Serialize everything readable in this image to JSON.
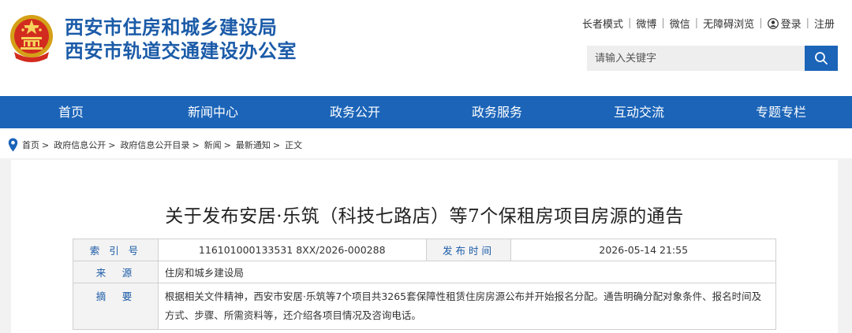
{
  "header": {
    "org_name_1": "西安市住房和城乡建设局",
    "org_name_2": "西安市轨道交通建设办公室",
    "emblem_icon": "national-emblem-icon",
    "toplinks": [
      "长者模式",
      "微博",
      "微信",
      "无障碍浏览"
    ],
    "login": "登录",
    "register": "注册",
    "search_placeholder": "请输入关键字",
    "accent_color": "#1b64b8"
  },
  "nav": {
    "items": [
      "首页",
      "新闻中心",
      "政务公开",
      "政务服务",
      "互动交流",
      "专题专栏"
    ]
  },
  "breadcrumb": [
    "首页",
    "政府信息公开",
    "政府信息公开目录",
    "新闻",
    "最新通知",
    "正文"
  ],
  "article": {
    "title": "关于发布安居·乐筑（科技七路店）等7个保租房项目房源的通告",
    "meta": {
      "index_label": "索 引 号",
      "index_value": "116101000133531 8XX/2026-000288",
      "date_label": "发布时间",
      "date_value": "2026-05-14 21:55",
      "source_label": "来　源",
      "source_value": "住房和城乡建设局",
      "summary_label": "摘　要",
      "summary_value": "根据相关文件精神，西安市安居·乐筑等7个项目共3265套保障性租赁住房房源公布并开始报名分配。通告明确分配对象条件、报名时间及方式、步骤、所需资料等，还介绍各项目情况及咨询电话。"
    }
  }
}
